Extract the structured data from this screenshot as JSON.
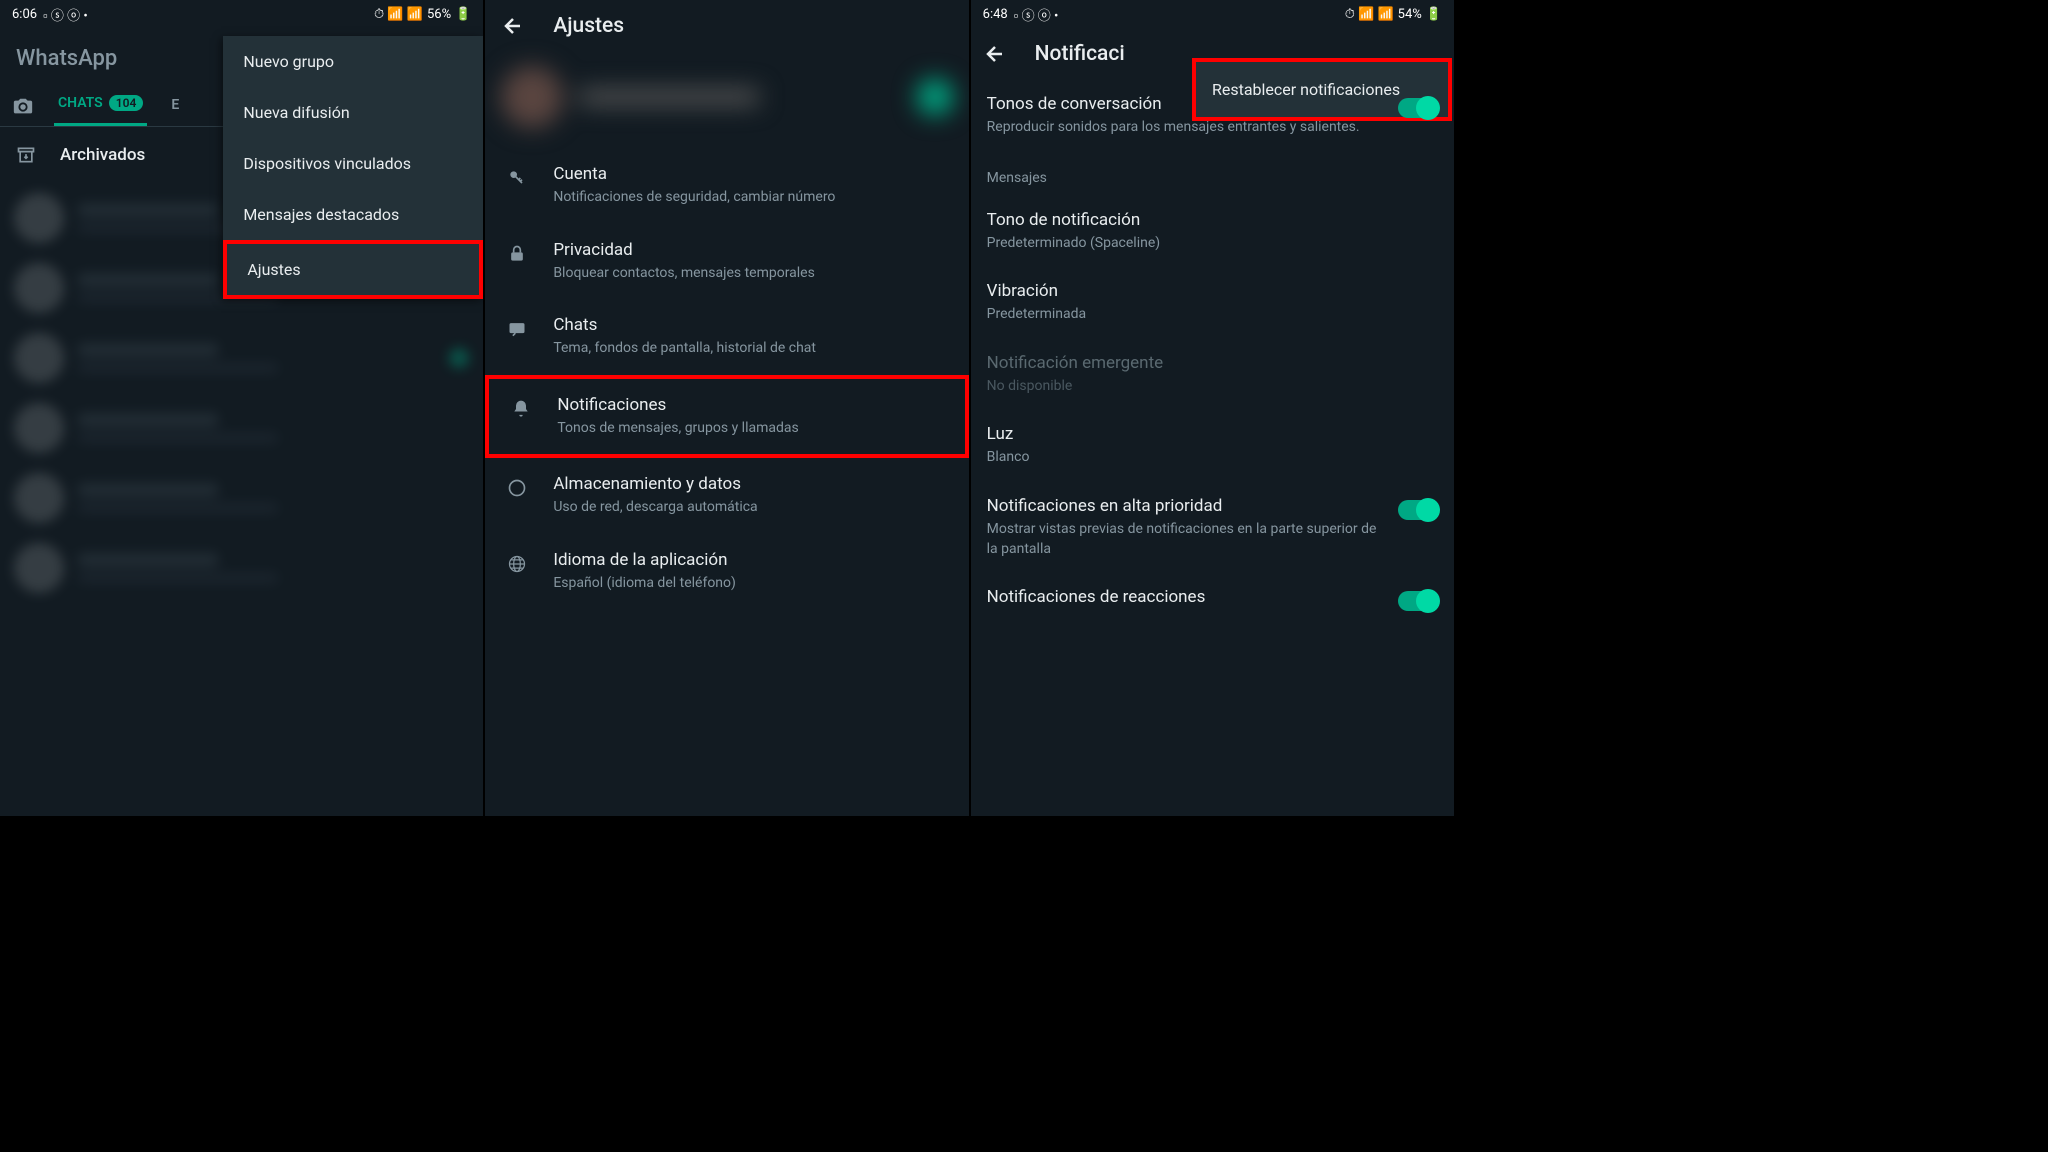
{
  "screen1": {
    "status": {
      "time": "6:06",
      "battery": "56%"
    },
    "app_title": "WhatsApp",
    "tabs": {
      "chats": "CHATS",
      "badge": "104",
      "estados_initial": "E"
    },
    "archived": "Archivados",
    "menu": {
      "items": [
        "Nuevo grupo",
        "Nueva difusión",
        "Dispositivos vinculados",
        "Mensajes destacados",
        "Ajustes"
      ]
    }
  },
  "screen2": {
    "title": "Ajustes",
    "items": [
      {
        "title": "Cuenta",
        "sub": "Notificaciones de seguridad, cambiar número"
      },
      {
        "title": "Privacidad",
        "sub": "Bloquear contactos, mensajes temporales"
      },
      {
        "title": "Chats",
        "sub": "Tema, fondos de pantalla, historial de chat"
      },
      {
        "title": "Notificaciones",
        "sub": "Tonos de mensajes, grupos y llamadas"
      },
      {
        "title": "Almacenamiento y datos",
        "sub": "Uso de red, descarga automática"
      },
      {
        "title": "Idioma de la aplicación",
        "sub": "Español (idioma del teléfono)"
      }
    ]
  },
  "screen3": {
    "status": {
      "time": "6:48",
      "battery": "54%"
    },
    "title": "Notificaci",
    "popup": "Restablecer notificaciones",
    "conversation_tones": {
      "title": "Tonos de conversación",
      "sub": "Reproducir sonidos para los mensajes entrantes y salientes."
    },
    "section_messages": "Mensajes",
    "items": {
      "tone": {
        "title": "Tono de notificación",
        "sub": "Predeterminado (Spaceline)"
      },
      "vibration": {
        "title": "Vibración",
        "sub": "Predeterminada"
      },
      "popup": {
        "title": "Notificación emergente",
        "sub": "No disponible"
      },
      "light": {
        "title": "Luz",
        "sub": "Blanco"
      },
      "priority": {
        "title": "Notificaciones en alta prioridad",
        "sub": "Mostrar vistas previas de notificaciones en la parte superior de la pantalla"
      },
      "reactions": {
        "title": "Notificaciones de reacciones"
      }
    }
  }
}
